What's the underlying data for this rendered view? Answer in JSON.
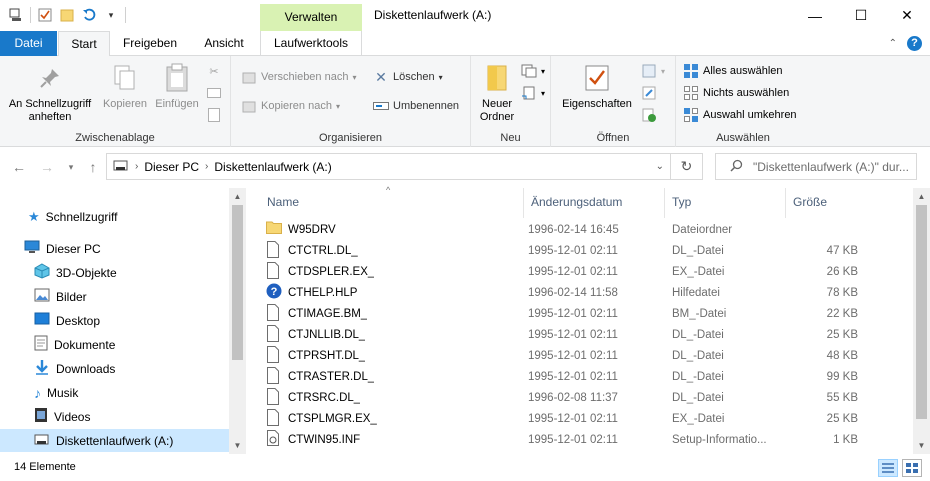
{
  "window": {
    "title": "Diskettenlaufwerk (A:)",
    "context_tab": "Verwalten",
    "minimize": "—",
    "maximize": "☐",
    "close": "✕"
  },
  "tabs": {
    "file": "Datei",
    "start": "Start",
    "share": "Freigeben",
    "view": "Ansicht",
    "drive_tools": "Laufwerktools",
    "help": "?"
  },
  "ribbon": {
    "clipboard": {
      "label": "Zwischenablage",
      "pin": "An Schnellzugriff anheften",
      "copy": "Kopieren",
      "paste": "Einfügen"
    },
    "organize": {
      "label": "Organisieren",
      "move_to": "Verschieben nach",
      "copy_to": "Kopieren nach",
      "delete": "Löschen",
      "rename": "Umbenennen"
    },
    "new": {
      "label": "Neu",
      "new_folder": "Neuer Ordner"
    },
    "open": {
      "label": "Öffnen",
      "properties": "Eigenschaften"
    },
    "select": {
      "label": "Auswählen",
      "select_all": "Alles auswählen",
      "select_none": "Nichts auswählen",
      "invert": "Auswahl umkehren"
    }
  },
  "address": {
    "crumbs": [
      "Dieser PC",
      "Diskettenlaufwerk (A:)"
    ],
    "search_placeholder": "\"Diskettenlaufwerk (A:)\" dur..."
  },
  "navpane": {
    "items": [
      {
        "label": "Schnellzugriff",
        "icon": "star-icon"
      },
      {
        "label": "Dieser PC",
        "icon": "pc-icon"
      },
      {
        "label": "3D-Objekte",
        "icon": "3d-objects-icon"
      },
      {
        "label": "Bilder",
        "icon": "pictures-icon"
      },
      {
        "label": "Desktop",
        "icon": "desktop-icon"
      },
      {
        "label": "Dokumente",
        "icon": "documents-icon"
      },
      {
        "label": "Downloads",
        "icon": "downloads-icon"
      },
      {
        "label": "Musik",
        "icon": "music-icon"
      },
      {
        "label": "Videos",
        "icon": "videos-icon"
      },
      {
        "label": "Diskettenlaufwerk (A:)",
        "icon": "floppy-drive-icon"
      }
    ]
  },
  "filelist": {
    "columns": {
      "name": "Name",
      "date": "Änderungsdatum",
      "type": "Typ",
      "size": "Größe"
    },
    "rows": [
      {
        "name": "W95DRV",
        "date": "1996-02-14 16:45",
        "type": "Dateiordner",
        "size": "",
        "icon": "folder"
      },
      {
        "name": "CTCTRL.DL_",
        "date": "1995-12-01 02:11",
        "type": "DL_-Datei",
        "size": "47 KB",
        "icon": "file"
      },
      {
        "name": "CTDSPLER.EX_",
        "date": "1995-12-01 02:11",
        "type": "EX_-Datei",
        "size": "26 KB",
        "icon": "file"
      },
      {
        "name": "CTHELP.HLP",
        "date": "1996-02-14 11:58",
        "type": "Hilfedatei",
        "size": "78 KB",
        "icon": "help"
      },
      {
        "name": "CTIMAGE.BM_",
        "date": "1995-12-01 02:11",
        "type": "BM_-Datei",
        "size": "22 KB",
        "icon": "file"
      },
      {
        "name": "CTJNLLIB.DL_",
        "date": "1995-12-01 02:11",
        "type": "DL_-Datei",
        "size": "25 KB",
        "icon": "file"
      },
      {
        "name": "CTPRSHT.DL_",
        "date": "1995-12-01 02:11",
        "type": "DL_-Datei",
        "size": "48 KB",
        "icon": "file"
      },
      {
        "name": "CTRASTER.DL_",
        "date": "1995-12-01 02:11",
        "type": "DL_-Datei",
        "size": "99 KB",
        "icon": "file"
      },
      {
        "name": "CTRSRC.DL_",
        "date": "1996-02-08 11:37",
        "type": "DL_-Datei",
        "size": "55 KB",
        "icon": "file"
      },
      {
        "name": "CTSPLMGR.EX_",
        "date": "1995-12-01 02:11",
        "type": "EX_-Datei",
        "size": "25 KB",
        "icon": "file"
      },
      {
        "name": "CTWIN95.INF",
        "date": "1995-12-01 02:11",
        "type": "Setup-Informatio...",
        "size": "1 KB",
        "icon": "inf"
      }
    ]
  },
  "status": {
    "count": "14 Elemente"
  }
}
